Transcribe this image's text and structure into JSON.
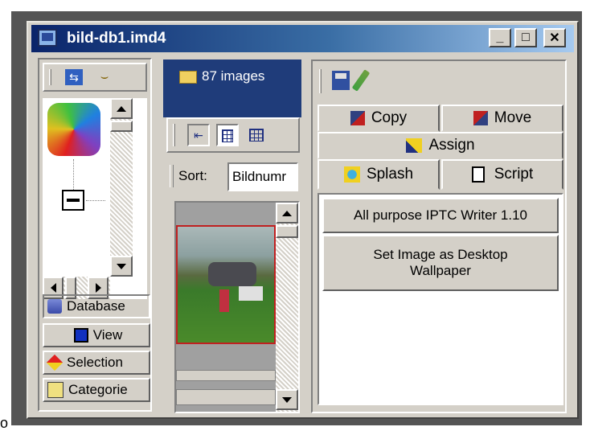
{
  "window": {
    "title": "bild-db1.imd4"
  },
  "titlebar_buttons": {
    "minimize": "_",
    "maximize": "□",
    "close": "✕"
  },
  "nav": {
    "items": [
      {
        "label": "Database",
        "icon": "database-icon"
      },
      {
        "label": "View",
        "icon": "view-icon"
      },
      {
        "label": "Selection",
        "icon": "selection-icon"
      },
      {
        "label": "Categorie",
        "icon": "categories-icon"
      }
    ]
  },
  "images_panel": {
    "header": "87 images",
    "sort_label": "Sort:",
    "sort_value": "Bildnumr"
  },
  "actions": {
    "tabs_row1": [
      {
        "label": "Copy"
      },
      {
        "label": "Move"
      }
    ],
    "tabs_row2": [
      {
        "label": "Assign"
      }
    ],
    "tabs_row3": [
      {
        "label": "Splash"
      },
      {
        "label": "Script"
      }
    ],
    "scripts": [
      "All purpose IPTC Writer 1.10",
      "Set Image as Desktop Wallpaper"
    ]
  },
  "colors": {
    "title_start": "#0a246a",
    "title_end": "#a6caf0",
    "images_header": "#1f3c7a",
    "face": "#d4d0c8"
  }
}
